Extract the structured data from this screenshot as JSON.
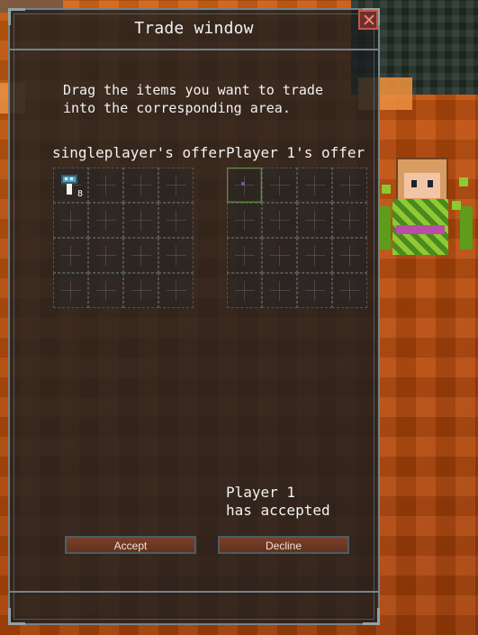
{
  "window": {
    "title": "Trade window",
    "instructions": "Drag the items you want to trade\ninto the corresponding area.",
    "left_offer_label": "singleplayer's offer",
    "right_offer_label": "Player 1's offer",
    "status_text": "Player 1\nhas accepted",
    "buttons": {
      "accept": "Accept",
      "decline": "Decline"
    }
  },
  "left_grid": {
    "item_count": "8",
    "item_icon": "mushroom-icon"
  },
  "right_grid": {
    "highlight_icon": "small-purple-item-icon"
  },
  "colors": {
    "window_border": "#748487",
    "panel_bg": "#1c1e20",
    "button_bg": "#6d3522",
    "accent_green": "#5f8a3f"
  }
}
